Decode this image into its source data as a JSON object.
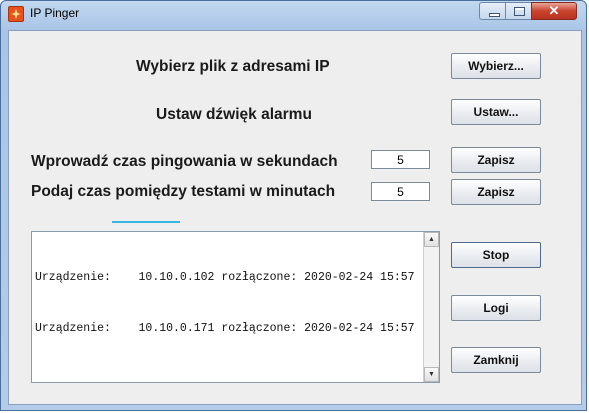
{
  "window": {
    "title": "IP Pinger",
    "close_glyph": "✕"
  },
  "rows": {
    "file": {
      "label": "Wybierz plik z adresami IP",
      "button": "Wybierz..."
    },
    "alarm": {
      "label": "Ustaw dźwięk alarmu",
      "button": "Ustaw..."
    },
    "ping_time": {
      "label": "Wprowadź czas pingowania w sekundach",
      "value": "5",
      "button": "Zapisz"
    },
    "test_interval": {
      "label": "Podaj czas pomiędzy testami w minutach",
      "value": "5",
      "button": "Zapisz"
    }
  },
  "log": {
    "lines": [
      "Urządzenie:    10.10.0.102 rozłączone: 2020-02-24 15:57",
      "Urządzenie:    10.10.0.171 rozłączone: 2020-02-24 15:57"
    ]
  },
  "actions": {
    "stop": "Stop",
    "logs": "Logi",
    "close": "Zamknij"
  },
  "icons": {
    "app": "app-icon",
    "minimize": "minimize-icon",
    "maximize": "maximize-icon",
    "close": "close-icon",
    "scroll_up": "▲",
    "scroll_down": "▼"
  },
  "colors": {
    "focus_accent": "#33b5e5",
    "close_button": "#c9432f"
  }
}
